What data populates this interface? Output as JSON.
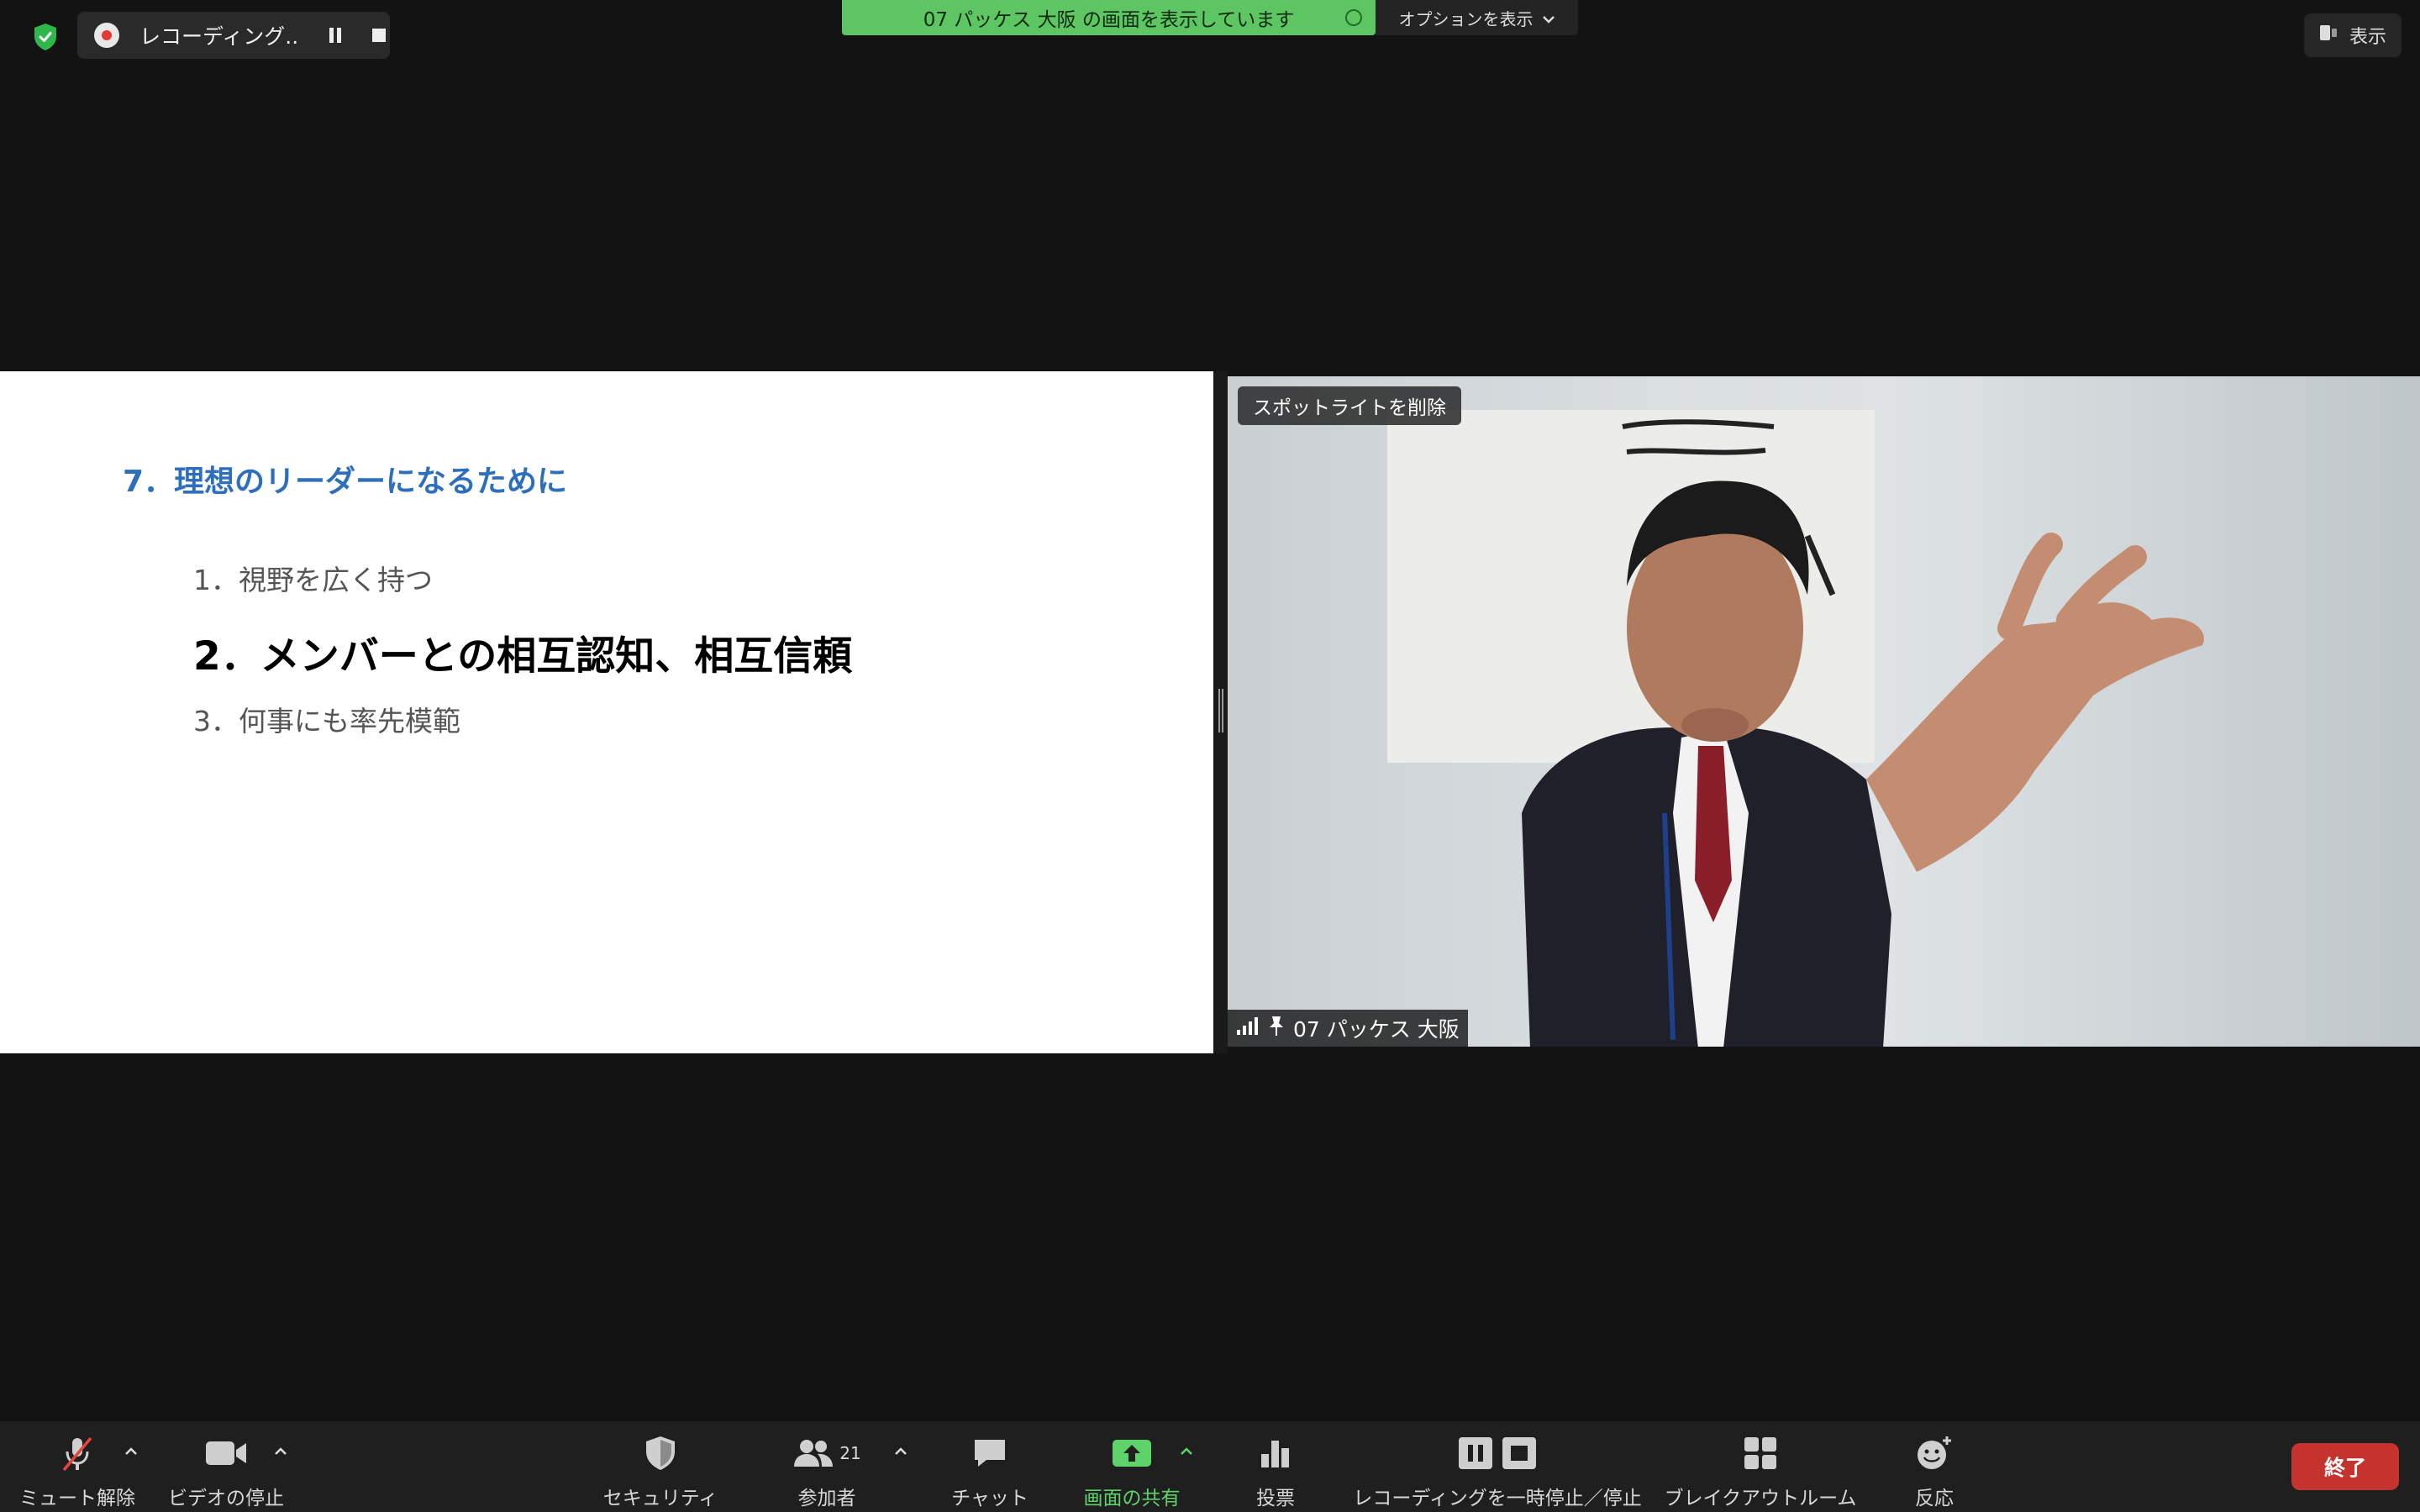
{
  "top_bar": {
    "recording_label": "レコーディング...",
    "share_banner": "07 パッケス 大阪 の画面を表示しています",
    "options_label": "オプションを表示",
    "view_label": "表示"
  },
  "slide": {
    "title": "7．理想のリーダーになるために",
    "items": [
      "1．視野を広く持つ",
      "2．メンバーとの相互認知、相互信頼",
      "3．何事にも率先模範"
    ]
  },
  "video": {
    "spotlight_button": "スポットライトを削除",
    "participant_name": "07 パッケス 大阪"
  },
  "toolbar": {
    "mute_label": "ミュート解除",
    "video_label": "ビデオの停止",
    "security_label": "セキュリティ",
    "participants_label": "参加者",
    "participants_count": "21",
    "chat_label": "チャット",
    "share_label": "画面の共有",
    "poll_label": "投票",
    "recording_label": "レコーディングを一時停止／停止",
    "breakout_label": "ブレイクアウトルーム",
    "reactions_label": "反応",
    "end_label": "終了"
  },
  "colors": {
    "background": "#131313",
    "share_green": "#5dc662",
    "slide_title_blue": "#2e6fbd",
    "end_red": "#c4332d"
  }
}
